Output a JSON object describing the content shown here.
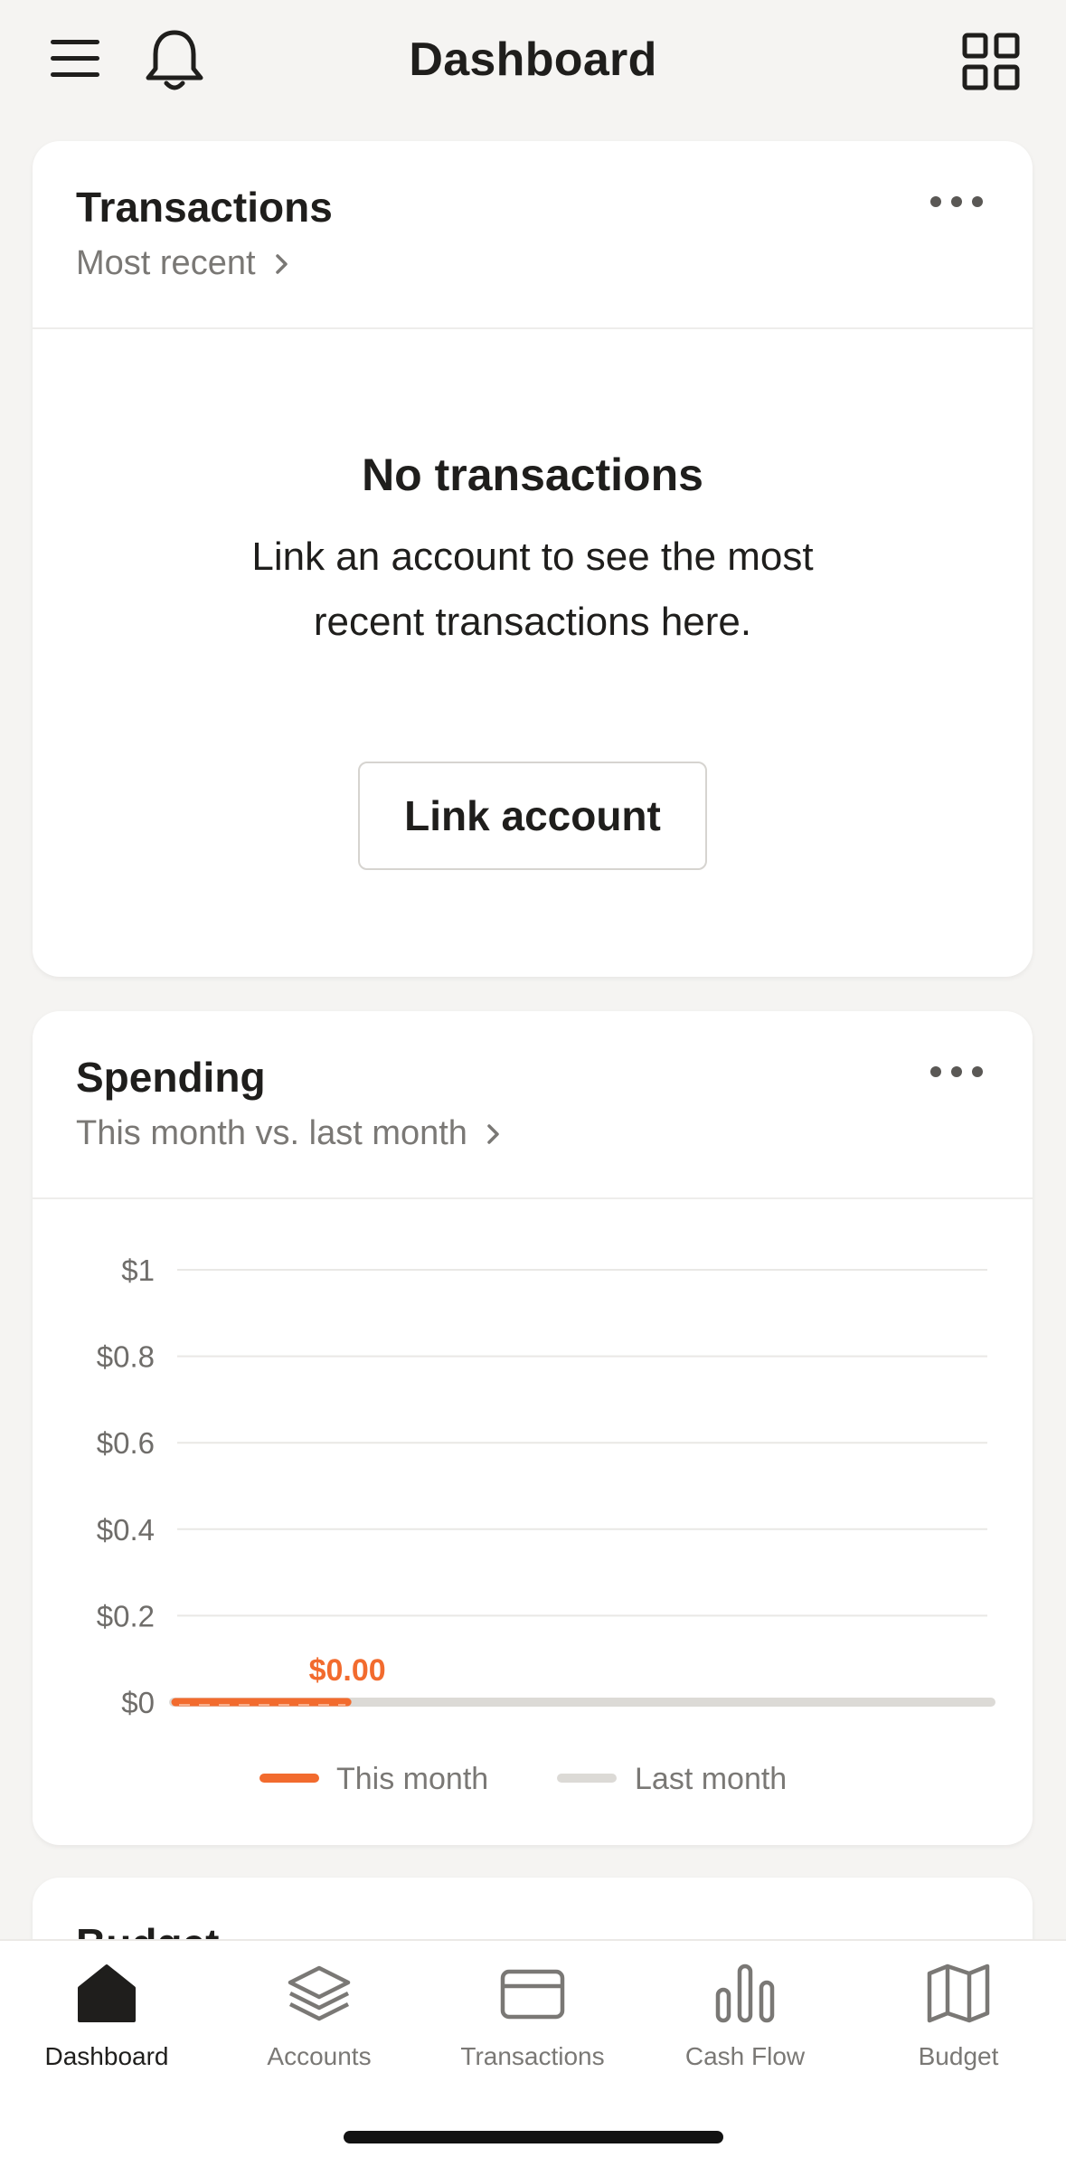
{
  "header": {
    "title": "Dashboard"
  },
  "transactions_card": {
    "title": "Transactions",
    "subtitle": "Most recent",
    "empty_title": "No transactions",
    "empty_body": "Link an account to see the most recent transactions here.",
    "button_label": "Link account"
  },
  "spending_card": {
    "title": "Spending",
    "subtitle": "This month vs. last month"
  },
  "budget_card": {
    "title": "Budget"
  },
  "chart_data": {
    "type": "area",
    "title": "",
    "xlabel": "",
    "ylabel": "",
    "ylim": [
      0,
      1
    ],
    "yticks": [
      "$0",
      "$0.2",
      "$0.4",
      "$0.6",
      "$0.8",
      "$1"
    ],
    "ytick_values": [
      0,
      0.2,
      0.4,
      0.6,
      0.8,
      1
    ],
    "grid": true,
    "legend_position": "bottom",
    "series": [
      {
        "name": "This month",
        "color": "#f26b2e",
        "values": [
          0,
          0,
          0,
          0,
          0,
          0,
          0,
          0
        ],
        "current_label": "$0.00",
        "extent_fraction": 0.21
      },
      {
        "name": "Last month",
        "color": "#dcdad6",
        "values": [
          0,
          0,
          0,
          0,
          0,
          0,
          0,
          0,
          0,
          0,
          0,
          0,
          0,
          0,
          0,
          0,
          0,
          0,
          0,
          0,
          0,
          0,
          0,
          0,
          0,
          0,
          0,
          0,
          0,
          0,
          0
        ],
        "extent_fraction": 1.0
      }
    ]
  },
  "tabbar": {
    "items": [
      {
        "label": "Dashboard",
        "icon": "home-icon",
        "active": true
      },
      {
        "label": "Accounts",
        "icon": "layers-icon",
        "active": false
      },
      {
        "label": "Transactions",
        "icon": "credit-card-icon",
        "active": false
      },
      {
        "label": "Cash Flow",
        "icon": "bar-chart-icon",
        "active": false
      },
      {
        "label": "Budget",
        "icon": "map-icon",
        "active": false
      }
    ]
  },
  "colors": {
    "accent": "#f26b2e",
    "muted": "#7a7875",
    "background": "#f5f4f2"
  }
}
